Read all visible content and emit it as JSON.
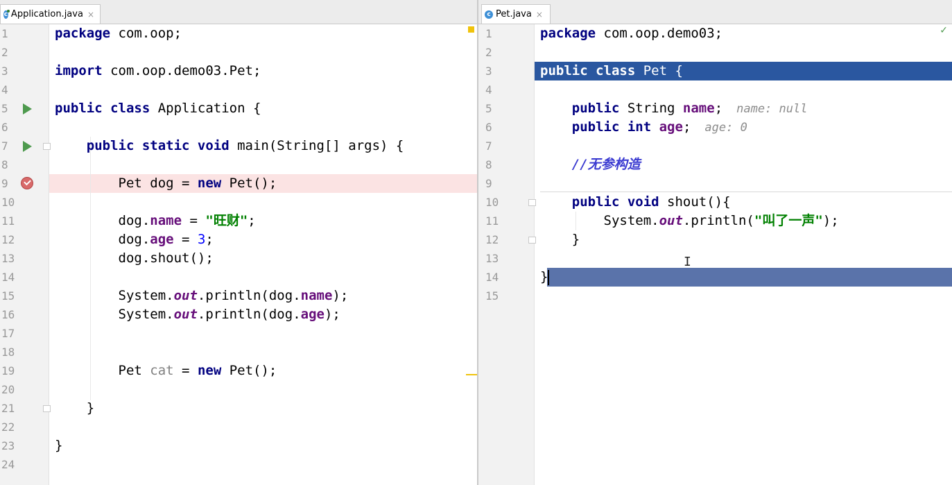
{
  "left_tab": {
    "title": "Application.java",
    "icon": "java-class-icon",
    "close": "×"
  },
  "right_tab": {
    "title": "Pet.java",
    "icon": "java-class-icon",
    "close": "×"
  },
  "left_numbers": [
    "1",
    "2",
    "3",
    "4",
    "5",
    "6",
    "7",
    "8",
    "9",
    "10",
    "11",
    "12",
    "13",
    "14",
    "15",
    "16",
    "17",
    "18",
    "19",
    "20",
    "21",
    "22",
    "23",
    "24"
  ],
  "right_numbers": [
    "1",
    "2",
    "3",
    "4",
    "5",
    "6",
    "7",
    "8",
    "9",
    "10",
    "11",
    "12",
    "13",
    "14",
    "15"
  ],
  "left_code": {
    "l1": [
      "package",
      " com.oop;"
    ],
    "l3": [
      "import",
      " com.oop.demo03.Pet;"
    ],
    "l5": [
      "public class",
      " Application {"
    ],
    "l7": [
      "    ",
      "public static void",
      " main(String[] args) {"
    ],
    "l9": [
      "        Pet dog = ",
      "new",
      " Pet();"
    ],
    "l11": [
      "        dog.",
      "name",
      " = ",
      "\"旺财\"",
      ";"
    ],
    "l12": [
      "        dog.",
      "age",
      " = ",
      "3",
      ";"
    ],
    "l13": [
      "        dog.shout();"
    ],
    "l15": [
      "        System.",
      "out",
      ".println(dog.",
      "name",
      ");"
    ],
    "l16": [
      "        System.",
      "out",
      ".println(dog.",
      "age",
      ");"
    ],
    "l19": [
      "        Pet ",
      "cat",
      " = ",
      "new",
      " Pet();"
    ],
    "l21": [
      "    }"
    ],
    "l23": [
      "}"
    ]
  },
  "right_code": {
    "l1": [
      "package",
      " com.oop.demo03;"
    ],
    "l3": [
      "public class",
      " Pet {"
    ],
    "l5": [
      "    ",
      "public",
      " String ",
      "name",
      ";",
      "name: null"
    ],
    "l6": [
      "    ",
      "public int",
      " ",
      "age",
      ";",
      "age: 0"
    ],
    "l8": [
      "    ",
      "//无参构造"
    ],
    "l10": [
      "    ",
      "public void",
      " shout(){"
    ],
    "l11": [
      "        System.",
      "out",
      ".println(",
      "\"叫了一声\"",
      ");"
    ],
    "l12": [
      "    }"
    ],
    "l14": [
      "}"
    ]
  },
  "status": {
    "check": "✓"
  },
  "colors": {
    "keyword": "#000080",
    "field": "#660e7a",
    "string": "#008000",
    "selection": "#2a57a0",
    "breakpoint_line": "#fbe3e3"
  }
}
